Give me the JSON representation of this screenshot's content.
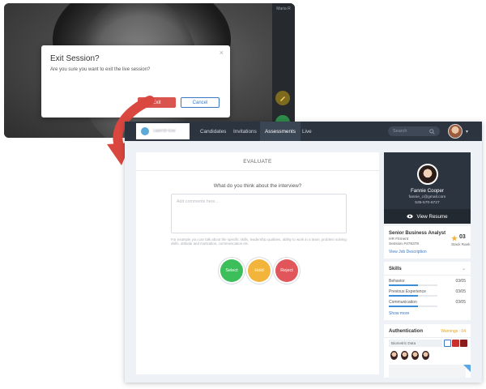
{
  "session": {
    "toolbar_label": "Maria R",
    "dialog": {
      "title": "Exit Session?",
      "message": "Are you sure you want to exit the live session?",
      "close": "×",
      "exit_label": "Exit",
      "cancel_label": "Cancel"
    }
  },
  "nav": {
    "logo_text": "TalentFlow",
    "items": [
      "Candidates",
      "Invitations",
      "Assessments",
      "Live"
    ],
    "active": "Assessments",
    "search_placeholder": "Search",
    "caret": "▾"
  },
  "evaluate": {
    "title": "EVALUATE",
    "question": "What do you think about the interview?",
    "comment_placeholder": "Add comments here...",
    "hint": "For example you can talk about the specific skills, leadership qualities, ability to work in a team, problem solving skills, attitude and motivation, communication etc.",
    "buttons": {
      "select": "Select",
      "hold": "Hold",
      "reject": "Reject"
    }
  },
  "profile": {
    "name": "Fannie Cooper",
    "email": "fannie_c@gmail.com",
    "phone": "535-570-6727",
    "view_resume": "View Resume"
  },
  "job": {
    "title": "Senior Business Analyst",
    "fitment": "HR Fitment",
    "session": "Session #478378",
    "rank": "03",
    "rank_label": "Stack Rank",
    "link": "View Job Description"
  },
  "skills": {
    "title": "Skills",
    "items": [
      {
        "name": "Behavior",
        "score": "03/05",
        "level": 0.6
      },
      {
        "name": "Previous Experience",
        "score": "03/05",
        "level": 0.6
      },
      {
        "name": "Communication",
        "score": "03/05",
        "level": 0.6
      }
    ],
    "show_more": "Show more"
  },
  "auth": {
    "title": "Authentication",
    "warning": "Warnings : 04",
    "biometric": "Biometric Data"
  },
  "colors": {
    "exit": "#d9534f",
    "select": "#3cbf5a",
    "hold": "#f2b43b",
    "reject": "#e0565b",
    "link": "#3a78c4",
    "nav_bg": "#2c3440"
  }
}
